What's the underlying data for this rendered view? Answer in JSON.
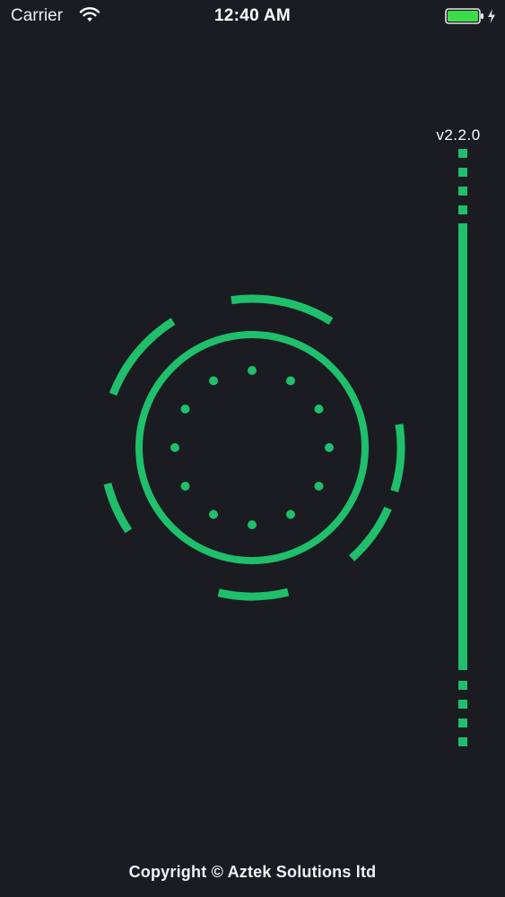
{
  "status_bar": {
    "carrier": "Carrier",
    "time": "12:40 AM",
    "icons": [
      "wifi-icon",
      "battery-icon",
      "charging-bolt-icon"
    ]
  },
  "version": "v2.2.0",
  "footer": {
    "copyright": "Copyright © Aztek Solutions ltd"
  },
  "theme": {
    "background": "#1b1c22",
    "accent": "#1fbf6b",
    "text": "#ffffff"
  },
  "loader": {
    "icon": "loading-spinner-icon",
    "dot_count": 12
  }
}
